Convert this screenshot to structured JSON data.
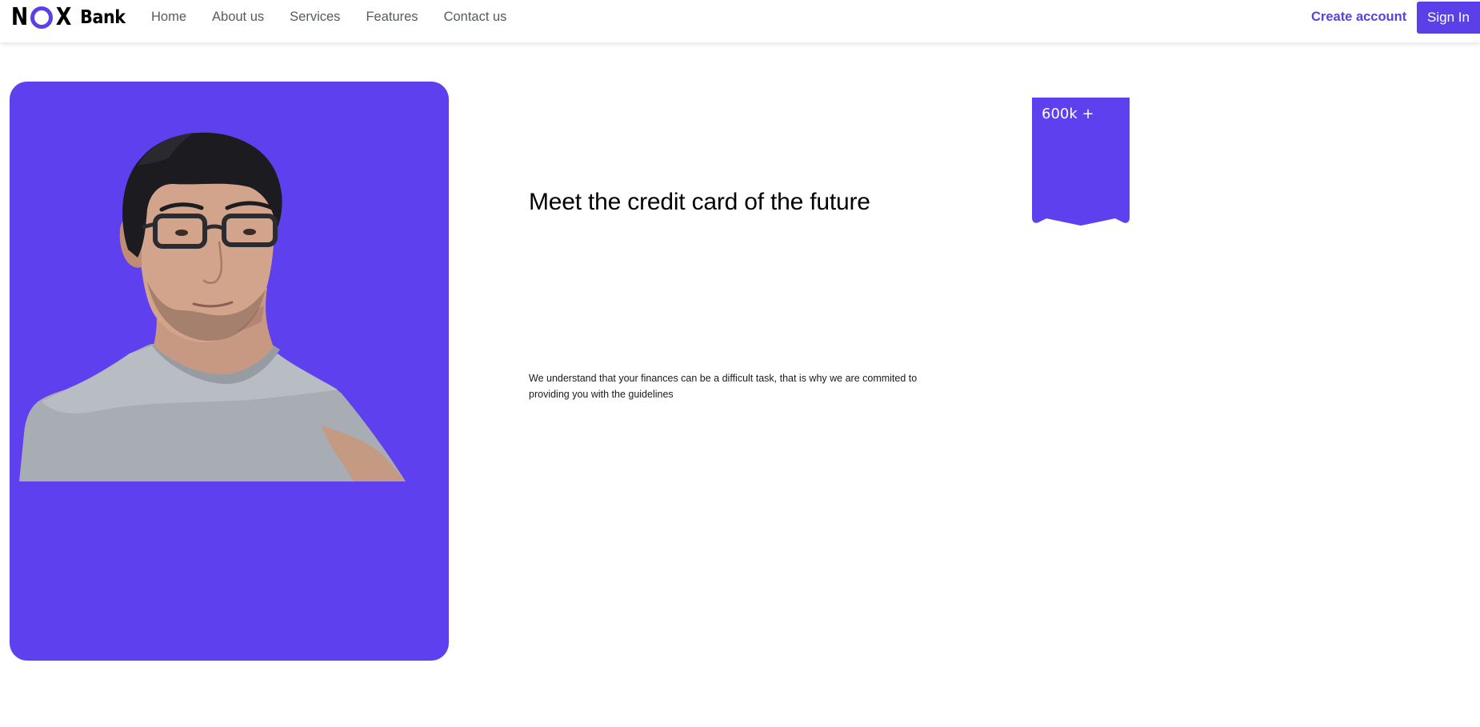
{
  "brand": {
    "logo_n": "N",
    "logo_x": "X",
    "logo_bank": "Bank",
    "accent_color": "#5b3fe8"
  },
  "nav": {
    "links": [
      "Home",
      "About us",
      "Services",
      "Features",
      "Contact us"
    ],
    "create_account": "Create account",
    "sign_in": "Sign In"
  },
  "hero": {
    "headline": "Meet the credit card of the future",
    "description": "We understand that your finances can be a difficult task, that is why we are commited to providing you with the guidelines",
    "badge": "600k +",
    "card_color": "#5e40ef",
    "image": "person-portrait"
  }
}
